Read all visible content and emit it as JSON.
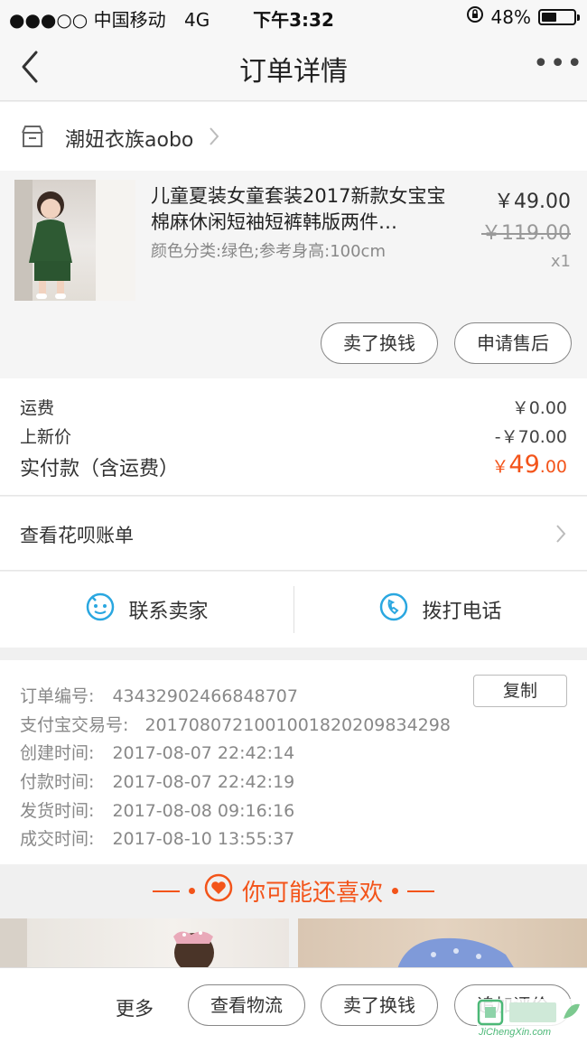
{
  "status_bar": {
    "carrier": "●●●○○ 中国移动",
    "network": "4G",
    "time": "下午3:32",
    "battery": "48%",
    "battery_level": 0.48
  },
  "nav": {
    "title": "订单详情",
    "more": "•••"
  },
  "shop": {
    "name": "潮妞衣族aobo"
  },
  "product": {
    "title": "儿童夏装女童套装2017新款女宝宝棉麻休闲短袖短裤韩版两件…",
    "spec": "颜色分类:绿色;参考身高:100cm",
    "price": "￥49.00",
    "original_price": "￥119.00",
    "quantity": "x1",
    "actions": [
      "卖了换钱",
      "申请售后"
    ]
  },
  "cost": {
    "shipping_label": "运费",
    "shipping_value": "￥0.00",
    "tradein_label": "上新价",
    "tradein_value": "-￥70.00",
    "paid_label": "实付款（含运费）",
    "paid_currency": "￥",
    "paid_int": "49",
    "paid_dec": ".00"
  },
  "huabei": {
    "label": "查看花呗账单"
  },
  "contact": {
    "seller": "联系卖家",
    "phone": "拨打电话"
  },
  "order_info": {
    "copy_label": "复制",
    "rows": [
      {
        "label": "订单编号:",
        "value": "43432902466848707"
      },
      {
        "label": "支付宝交易号:",
        "value": "2017080721001001820209834298"
      },
      {
        "label": "创建时间:",
        "value": "2017-08-07 22:42:14"
      },
      {
        "label": "付款时间:",
        "value": "2017-08-07 22:42:19"
      },
      {
        "label": "发货时间:",
        "value": "2017-08-08 09:16:16"
      },
      {
        "label": "成交时间:",
        "value": "2017-08-10 13:55:37"
      }
    ]
  },
  "recommend": {
    "title": "你可能还喜欢"
  },
  "bottom": {
    "more": "更多",
    "buttons": [
      "查看物流",
      "卖了换钱",
      "追加评价"
    ]
  },
  "watermark": {
    "text": "JiChengXin.com"
  },
  "colors": {
    "accent": "#f3541a",
    "icon_blue": "#2aa7e0"
  }
}
